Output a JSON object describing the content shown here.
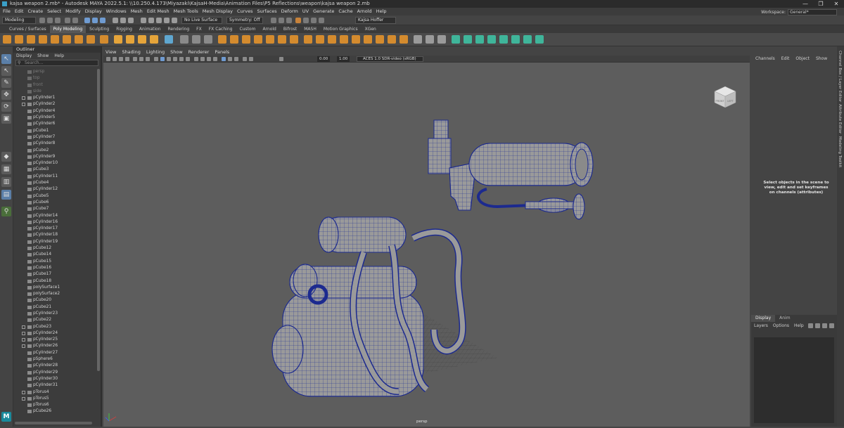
{
  "titlebar": {
    "title": "kajsa weapon 2.mb* - Autodesk MAYA 2022.5.1: \\\\10.250.4.173\\Miyazaki\\KajsaH-Media\\Animation Files\\P5 Reflections\\weapon\\kajsa weapon 2.mb",
    "minimize": "—",
    "maximize": "❐",
    "close": "✕"
  },
  "menubar": {
    "items": [
      "File",
      "Edit",
      "Create",
      "Select",
      "Modify",
      "Display",
      "Windows",
      "Mesh",
      "Edit Mesh",
      "Mesh Tools",
      "Mesh Display",
      "Curves",
      "Surfaces",
      "Deform",
      "UV",
      "Generate",
      "Cache",
      "Arnold",
      "Help"
    ],
    "workspace_label": "Workspace:",
    "workspace_value": "General*"
  },
  "statusline": {
    "mode_value": "Modeling",
    "live_surface": "No Live Surface",
    "symmetry": "Symmetry: Off",
    "user": "Kajsa Hoffer"
  },
  "shelf_tabs": {
    "items": [
      "Curves / Surfaces",
      "Poly Modeling",
      "Sculpting",
      "Rigging",
      "Animation",
      "Rendering",
      "FX",
      "FX Caching",
      "Custom",
      "Arnold",
      "Bifrost",
      "MASH",
      "Motion Graphics",
      "XGen"
    ],
    "active": "Poly Modeling"
  },
  "outliner": {
    "title": "Outliner",
    "menu": [
      "Display",
      "Show",
      "Help"
    ],
    "search_placeholder": "Search...",
    "items": [
      {
        "label": "persp",
        "kind": "cam",
        "expandable": false
      },
      {
        "label": "top",
        "kind": "cam",
        "expandable": false
      },
      {
        "label": "front",
        "kind": "cam",
        "expandable": false
      },
      {
        "label": "side",
        "kind": "cam",
        "expandable": false
      },
      {
        "label": "pCylinder1",
        "kind": "mesh",
        "expandable": true
      },
      {
        "label": "pCylinder2",
        "kind": "mesh",
        "expandable": true
      },
      {
        "label": "pCylinder4",
        "kind": "mesh",
        "expandable": false
      },
      {
        "label": "pCylinder5",
        "kind": "mesh",
        "expandable": false
      },
      {
        "label": "pCylinder6",
        "kind": "mesh",
        "expandable": false
      },
      {
        "label": "pCube1",
        "kind": "mesh",
        "expandable": false
      },
      {
        "label": "pCylinder7",
        "kind": "mesh",
        "expandable": false
      },
      {
        "label": "pCylinder8",
        "kind": "mesh",
        "expandable": false
      },
      {
        "label": "pCube2",
        "kind": "mesh",
        "expandable": false
      },
      {
        "label": "pCylinder9",
        "kind": "mesh",
        "expandable": false
      },
      {
        "label": "pCylinder10",
        "kind": "mesh",
        "expandable": false
      },
      {
        "label": "pCube3",
        "kind": "mesh",
        "expandable": false
      },
      {
        "label": "pCylinder11",
        "kind": "mesh",
        "expandable": false
      },
      {
        "label": "pCube4",
        "kind": "mesh",
        "expandable": false
      },
      {
        "label": "pCylinder12",
        "kind": "mesh",
        "expandable": false
      },
      {
        "label": "pCube5",
        "kind": "mesh",
        "expandable": false
      },
      {
        "label": "pCube6",
        "kind": "mesh",
        "expandable": false
      },
      {
        "label": "pCube7",
        "kind": "mesh",
        "expandable": false
      },
      {
        "label": "pCylinder14",
        "kind": "mesh",
        "expandable": false
      },
      {
        "label": "pCylinder16",
        "kind": "mesh",
        "expandable": false
      },
      {
        "label": "pCylinder17",
        "kind": "mesh",
        "expandable": false
      },
      {
        "label": "pCylinder18",
        "kind": "mesh",
        "expandable": false
      },
      {
        "label": "pCylinder19",
        "kind": "mesh",
        "expandable": false
      },
      {
        "label": "pCube12",
        "kind": "mesh",
        "expandable": false
      },
      {
        "label": "pCube14",
        "kind": "mesh",
        "expandable": false
      },
      {
        "label": "pCube15",
        "kind": "mesh",
        "expandable": false
      },
      {
        "label": "pCube16",
        "kind": "mesh",
        "expandable": false
      },
      {
        "label": "pCube17",
        "kind": "mesh",
        "expandable": false
      },
      {
        "label": "pCube18",
        "kind": "mesh",
        "expandable": false
      },
      {
        "label": "polySurface1",
        "kind": "mesh",
        "expandable": false
      },
      {
        "label": "polySurface2",
        "kind": "mesh",
        "expandable": false
      },
      {
        "label": "pCube20",
        "kind": "mesh",
        "expandable": false
      },
      {
        "label": "pCube21",
        "kind": "mesh",
        "expandable": false
      },
      {
        "label": "pCylinder23",
        "kind": "mesh",
        "expandable": false
      },
      {
        "label": "pCube22",
        "kind": "mesh",
        "expandable": false
      },
      {
        "label": "pCube23",
        "kind": "mesh",
        "expandable": true
      },
      {
        "label": "pCylinder24",
        "kind": "mesh",
        "expandable": true
      },
      {
        "label": "pCylinder25",
        "kind": "mesh",
        "expandable": true
      },
      {
        "label": "pCylinder26",
        "kind": "mesh",
        "expandable": true
      },
      {
        "label": "pCylinder27",
        "kind": "mesh",
        "expandable": false
      },
      {
        "label": "pSphere6",
        "kind": "mesh",
        "expandable": false
      },
      {
        "label": "pCylinder28",
        "kind": "mesh",
        "expandable": false
      },
      {
        "label": "pCylinder29",
        "kind": "mesh",
        "expandable": false
      },
      {
        "label": "pCylinder30",
        "kind": "mesh",
        "expandable": false
      },
      {
        "label": "pCylinder31",
        "kind": "mesh",
        "expandable": false
      },
      {
        "label": "pTorus4",
        "kind": "mesh",
        "expandable": true
      },
      {
        "label": "pTorus5",
        "kind": "mesh",
        "expandable": true
      },
      {
        "label": "pTorus6",
        "kind": "mesh",
        "expandable": false
      },
      {
        "label": "pCube26",
        "kind": "mesh",
        "expandable": false
      }
    ]
  },
  "viewport": {
    "menu": [
      "View",
      "Shading",
      "Lighting",
      "Show",
      "Renderer",
      "Panels"
    ],
    "field_a": "0.00",
    "field_b": "1.00",
    "color_space": "ACES 1.0 SDR-video (sRGB)",
    "camera_label": "persp",
    "viewcube_front": "FRONT",
    "viewcube_left": "LEFT",
    "wire_color": "#1c2a8f",
    "mesh_color": "#9a9a9a"
  },
  "channel_box": {
    "menu": [
      "Channels",
      "Edit",
      "Object",
      "Show"
    ],
    "message": "Select objects in the scene to view, edit and set keyframes on channels (attributes)"
  },
  "layer_editor": {
    "tabs": [
      "Display",
      "Anim"
    ],
    "active_tab": "Display",
    "menu": [
      "Layers",
      "Options",
      "Help"
    ]
  },
  "side_tabs": [
    "Channel Box / Layer Editor",
    "Attribute Editor",
    "Modeling Toolkit"
  ]
}
